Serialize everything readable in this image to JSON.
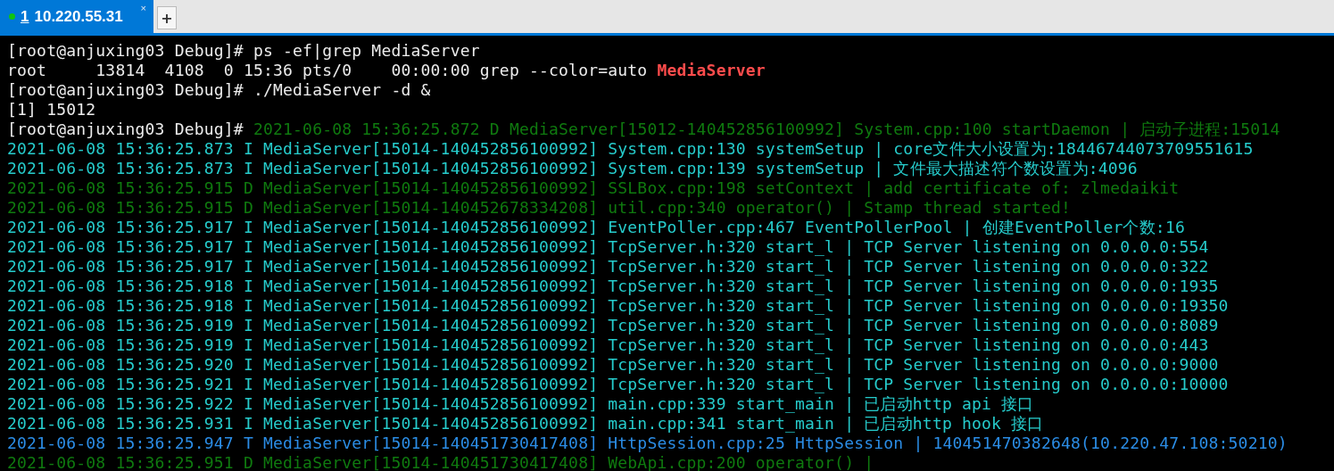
{
  "tabs": [
    {
      "number": "1",
      "title": "10.220.55.31",
      "connected": true,
      "selected": true,
      "close": "×"
    }
  ],
  "new_tab": "+",
  "terminal": {
    "lines": [
      {
        "segments": [
          {
            "kind": "plain",
            "text": "[root@anjuxing03 Debug]# ps -ef|grep MediaServer"
          }
        ]
      },
      {
        "segments": [
          {
            "kind": "plain",
            "text": "root     13814  4108  0 15:36 pts/0    00:00:00 grep --color=auto "
          },
          {
            "kind": "match",
            "text": "MediaServer"
          }
        ]
      },
      {
        "segments": [
          {
            "kind": "plain",
            "text": "[root@anjuxing03 Debug]# ./MediaServer -d &"
          }
        ]
      },
      {
        "segments": [
          {
            "kind": "plain",
            "text": "[1] 15012"
          }
        ]
      },
      {
        "segments": [
          {
            "kind": "plain",
            "text": "[root@anjuxing03 Debug]# "
          },
          {
            "kind": "debug",
            "text": "2021-06-08 15:36:25.872 D MediaServer[15012-140452856100992] System.cpp:100 startDaemon | 启动子进程:15014"
          }
        ]
      },
      {
        "segments": [
          {
            "kind": "info",
            "text": "2021-06-08 15:36:25.873 I MediaServer[15014-140452856100992] System.cpp:130 systemSetup | core文件大小设置为:18446744073709551615"
          }
        ]
      },
      {
        "segments": [
          {
            "kind": "info",
            "text": "2021-06-08 15:36:25.873 I MediaServer[15014-140452856100992] System.cpp:139 systemSetup | 文件最大描述符个数设置为:4096"
          }
        ]
      },
      {
        "segments": [
          {
            "kind": "debug",
            "text": "2021-06-08 15:36:25.915 D MediaServer[15014-140452856100992] SSLBox.cpp:198 setContext | add certificate of: zlmedaikit"
          }
        ]
      },
      {
        "segments": [
          {
            "kind": "debug",
            "text": "2021-06-08 15:36:25.915 D MediaServer[15014-140452678334208] util.cpp:340 operator() | Stamp thread started!"
          }
        ]
      },
      {
        "segments": [
          {
            "kind": "info",
            "text": "2021-06-08 15:36:25.917 I MediaServer[15014-140452856100992] EventPoller.cpp:467 EventPollerPool | 创建EventPoller个数:16"
          }
        ]
      },
      {
        "segments": [
          {
            "kind": "info",
            "text": "2021-06-08 15:36:25.917 I MediaServer[15014-140452856100992] TcpServer.h:320 start_l | TCP Server listening on 0.0.0.0:554"
          }
        ]
      },
      {
        "segments": [
          {
            "kind": "info",
            "text": "2021-06-08 15:36:25.917 I MediaServer[15014-140452856100992] TcpServer.h:320 start_l | TCP Server listening on 0.0.0.0:322"
          }
        ]
      },
      {
        "segments": [
          {
            "kind": "info",
            "text": "2021-06-08 15:36:25.918 I MediaServer[15014-140452856100992] TcpServer.h:320 start_l | TCP Server listening on 0.0.0.0:1935"
          }
        ]
      },
      {
        "segments": [
          {
            "kind": "info",
            "text": "2021-06-08 15:36:25.918 I MediaServer[15014-140452856100992] TcpServer.h:320 start_l | TCP Server listening on 0.0.0.0:19350"
          }
        ]
      },
      {
        "segments": [
          {
            "kind": "info",
            "text": "2021-06-08 15:36:25.919 I MediaServer[15014-140452856100992] TcpServer.h:320 start_l | TCP Server listening on 0.0.0.0:8089"
          }
        ]
      },
      {
        "segments": [
          {
            "kind": "info",
            "text": "2021-06-08 15:36:25.919 I MediaServer[15014-140452856100992] TcpServer.h:320 start_l | TCP Server listening on 0.0.0.0:443"
          }
        ]
      },
      {
        "segments": [
          {
            "kind": "info",
            "text": "2021-06-08 15:36:25.920 I MediaServer[15014-140452856100992] TcpServer.h:320 start_l | TCP Server listening on 0.0.0.0:9000"
          }
        ]
      },
      {
        "segments": [
          {
            "kind": "info",
            "text": "2021-06-08 15:36:25.921 I MediaServer[15014-140452856100992] TcpServer.h:320 start_l | TCP Server listening on 0.0.0.0:10000"
          }
        ]
      },
      {
        "segments": [
          {
            "kind": "info",
            "text": "2021-06-08 15:36:25.922 I MediaServer[15014-140452856100992] main.cpp:339 start_main | 已启动http api 接口"
          }
        ]
      },
      {
        "segments": [
          {
            "kind": "info",
            "text": "2021-06-08 15:36:25.931 I MediaServer[15014-140452856100992] main.cpp:341 start_main | 已启动http hook 接口"
          }
        ]
      },
      {
        "segments": [
          {
            "kind": "trace",
            "text": "2021-06-08 15:36:25.947 T MediaServer[15014-140451730417408] HttpSession.cpp:25 HttpSession | 140451470382648(10.220.47.108:50210)"
          }
        ]
      },
      {
        "segments": [
          {
            "kind": "debug",
            "text": "2021-06-08 15:36:25.951 D MediaServer[15014-140451730417408] WebApi.cpp:200 operator() |"
          }
        ]
      }
    ]
  }
}
